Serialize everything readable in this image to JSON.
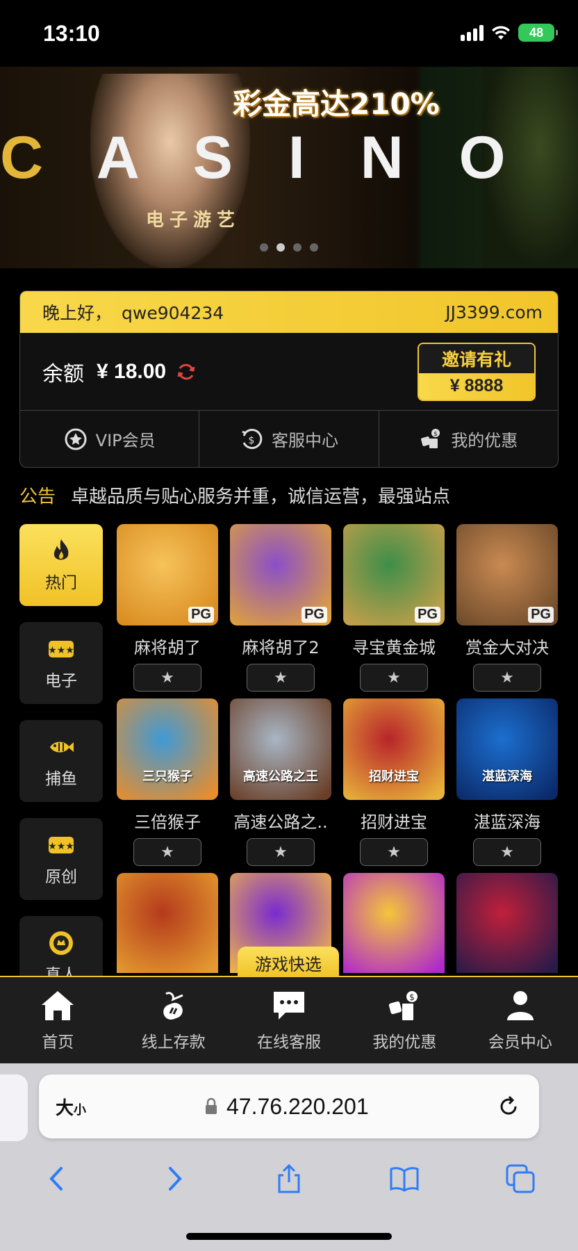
{
  "status": {
    "time": "13:10",
    "battery": "48"
  },
  "banner": {
    "headline": "彩金高达210%",
    "brand_word": "CASINO",
    "subtitle": "电子游艺",
    "dots": 4,
    "active_dot": 2
  },
  "account": {
    "greeting": "晚上好，",
    "username": "qwe904234",
    "site": "JJ3399.com",
    "balance_label": "余额",
    "balance_value": "¥ 18.00",
    "invite_title": "邀请有礼",
    "invite_amount": "¥ 8888",
    "actions": [
      {
        "label": "VIP会员",
        "icon": "vip-icon"
      },
      {
        "label": "客服中心",
        "icon": "customer-service-icon"
      },
      {
        "label": "我的优惠",
        "icon": "promotions-icon"
      }
    ]
  },
  "notice": {
    "label": "公告",
    "text": "卓越品质与贴心服务并重，诚信运营，最强站点"
  },
  "categories": [
    {
      "label": "热门",
      "icon": "flame-icon",
      "active": true
    },
    {
      "label": "电子",
      "icon": "slot-icon",
      "active": false
    },
    {
      "label": "捕鱼",
      "icon": "fish-icon",
      "active": false
    },
    {
      "label": "原创",
      "icon": "slot-icon",
      "active": false
    },
    {
      "label": "真人",
      "icon": "chip-icon",
      "active": false
    }
  ],
  "games": [
    {
      "name": "麻将胡了",
      "badge": "PG",
      "caption": "",
      "colors": [
        "#f6c35a",
        "#d88a1f"
      ]
    },
    {
      "name": "麻将胡了2",
      "badge": "PG",
      "caption": "",
      "colors": [
        "#8a4fc9",
        "#e0a23a"
      ]
    },
    {
      "name": "寻宝黄金城",
      "badge": "PG",
      "caption": "",
      "colors": [
        "#3e8e4a",
        "#c9a04a"
      ]
    },
    {
      "name": "赏金大对决",
      "badge": "PG",
      "caption": "",
      "colors": [
        "#c98a52",
        "#6d4a2a"
      ]
    },
    {
      "name": "三倍猴子",
      "badge": "",
      "caption": "三只猴子",
      "colors": [
        "#3f9ad6",
        "#e88d2c"
      ]
    },
    {
      "name": "高速公路之..",
      "badge": "",
      "caption": "高速公路之王",
      "colors": [
        "#a8b6c4",
        "#6a3f28"
      ]
    },
    {
      "name": "招财进宝",
      "badge": "",
      "caption": "招财进宝",
      "colors": [
        "#b8242a",
        "#e8b33a"
      ]
    },
    {
      "name": "湛蓝深海",
      "badge": "",
      "caption": "湛蓝深海",
      "colors": [
        "#1c6fcf",
        "#0b2a6a"
      ]
    },
    {
      "name": "",
      "badge": "",
      "caption": "",
      "colors": [
        "#b53a1c",
        "#e39a2f"
      ]
    },
    {
      "name": "",
      "badge": "",
      "caption": "",
      "colors": [
        "#7a2bd0",
        "#f0b44a"
      ]
    },
    {
      "name": "",
      "badge": "",
      "caption": "",
      "colors": [
        "#f4c53a",
        "#b02acb"
      ]
    },
    {
      "name": "",
      "badge": "",
      "caption": "",
      "colors": [
        "#c0203a",
        "#2a1a4a"
      ]
    }
  ],
  "quick_pick": "游戏快选",
  "nav": [
    {
      "label": "首页",
      "icon": "home-icon"
    },
    {
      "label": "线上存款",
      "icon": "deposit-icon"
    },
    {
      "label": "在线客服",
      "icon": "chat-icon"
    },
    {
      "label": "我的优惠",
      "icon": "promotions-icon"
    },
    {
      "label": "会员中心",
      "icon": "user-icon"
    }
  ],
  "browser": {
    "size_label": "大",
    "size_label_small": "小",
    "url": "47.76.220.201"
  },
  "colors": {
    "accent": "#f2c738",
    "background": "#000000"
  }
}
